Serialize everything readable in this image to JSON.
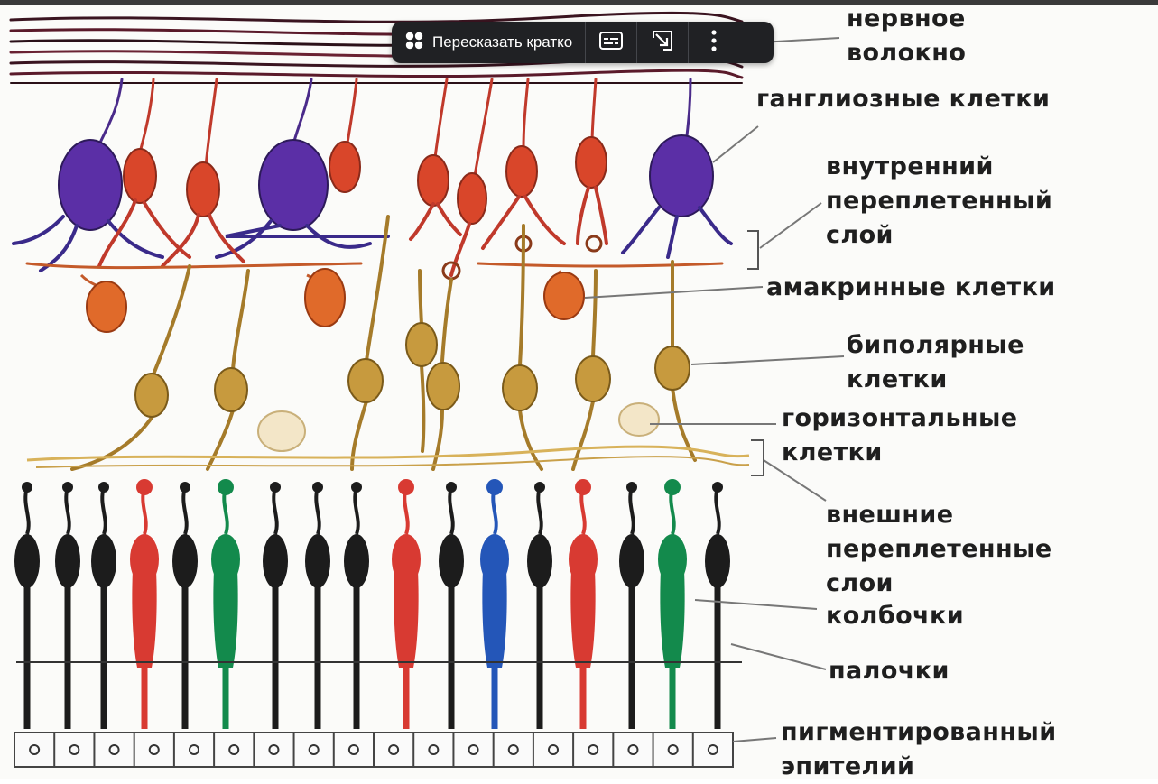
{
  "toolbar": {
    "summarize_label": "Пересказать кратко",
    "icons": [
      "sparkle-dots-icon",
      "subtitles-icon",
      "open-in-panel-icon",
      "more-vertical-icon"
    ]
  },
  "labels": {
    "nerve_fiber": [
      "нервное",
      "волокно"
    ],
    "ganglion_cells": [
      "ганглиозные клетки"
    ],
    "inner_plexiform": [
      "внутренний",
      "переплетенный",
      "слой"
    ],
    "amacrine": [
      "амакринные клетки"
    ],
    "bipolar": [
      "биполярные",
      "клетки"
    ],
    "horizontal": [
      "горизонтальные",
      "клетки"
    ],
    "outer_plexiform": [
      "внешние",
      "переплетенные",
      "слои"
    ],
    "cones": [
      "колбочки"
    ],
    "rods": [
      "палочки"
    ],
    "pigment_epithelium": [
      "пигментированный",
      "эпителий"
    ]
  },
  "colors": {
    "ganglion_purple": "#5b2fa6",
    "ganglion_red": "#d9462a",
    "bipolar_gold": "#b8892f",
    "rod_black": "#1c1c1c",
    "cone_red": "#d83a32",
    "cone_green": "#138a4c",
    "cone_blue": "#2456b8",
    "toolbar_bg": "#202124"
  }
}
